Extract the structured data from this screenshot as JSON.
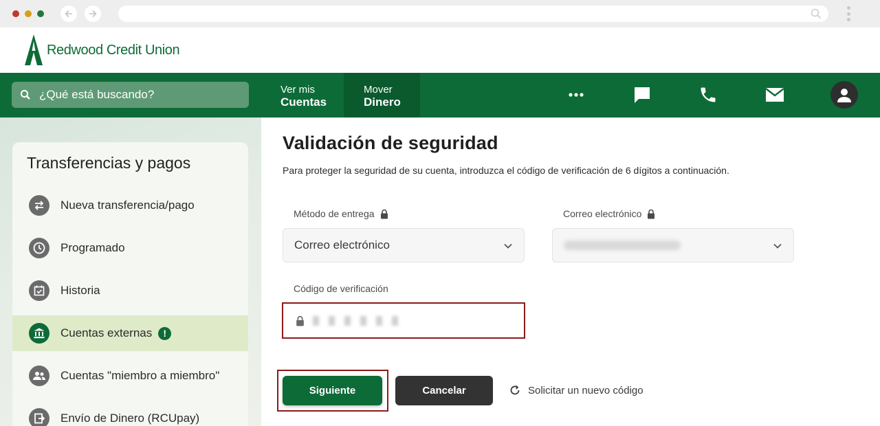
{
  "brand": {
    "name": "Redwood Credit Union",
    "primary_color": "#0d6b37",
    "dark_green": "#0a5a2d",
    "alert_border": "#8b1a1a"
  },
  "browser": {
    "icons": [
      "arrow-left-icon",
      "arrow-right-icon",
      "search-icon",
      "kebab-icon"
    ]
  },
  "nav": {
    "search_placeholder": "¿Qué está buscando?",
    "tabs": [
      {
        "small": "Ver mis",
        "big": "Cuentas"
      },
      {
        "small": "Mover",
        "big": "Dinero",
        "active": true
      }
    ],
    "icons": [
      "more-icon",
      "chat-icon",
      "phone-icon",
      "mail-icon",
      "user-icon"
    ]
  },
  "sidebar": {
    "title": "Transferencias y pagos",
    "items": [
      {
        "label": "Nueva transferencia/pago",
        "icon": "transfer-icon"
      },
      {
        "label": "Programado",
        "icon": "clock-icon"
      },
      {
        "label": "Historia",
        "icon": "calendar-check-icon"
      },
      {
        "label": "Cuentas externas",
        "icon": "bank-icon",
        "active": true,
        "badge": "!"
      },
      {
        "label": "Cuentas \"miembro a miembro\"",
        "icon": "members-icon"
      },
      {
        "label": "Envío de Dinero (RCUpay)",
        "icon": "send-money-icon"
      }
    ]
  },
  "main": {
    "title": "Validación de seguridad",
    "description": "Para proteger la seguridad de su cuenta, introduzca el código de verificación de 6 dígitos a continuación.",
    "delivery_method": {
      "label": "Método de entrega",
      "value": "Correo electrónico"
    },
    "email": {
      "label": "Correo electrónico"
    },
    "verification_code": {
      "label": "Código de verificación"
    },
    "buttons": {
      "next": "Siguiente",
      "cancel": "Cancelar",
      "resend": "Solicitar un nuevo código"
    }
  }
}
